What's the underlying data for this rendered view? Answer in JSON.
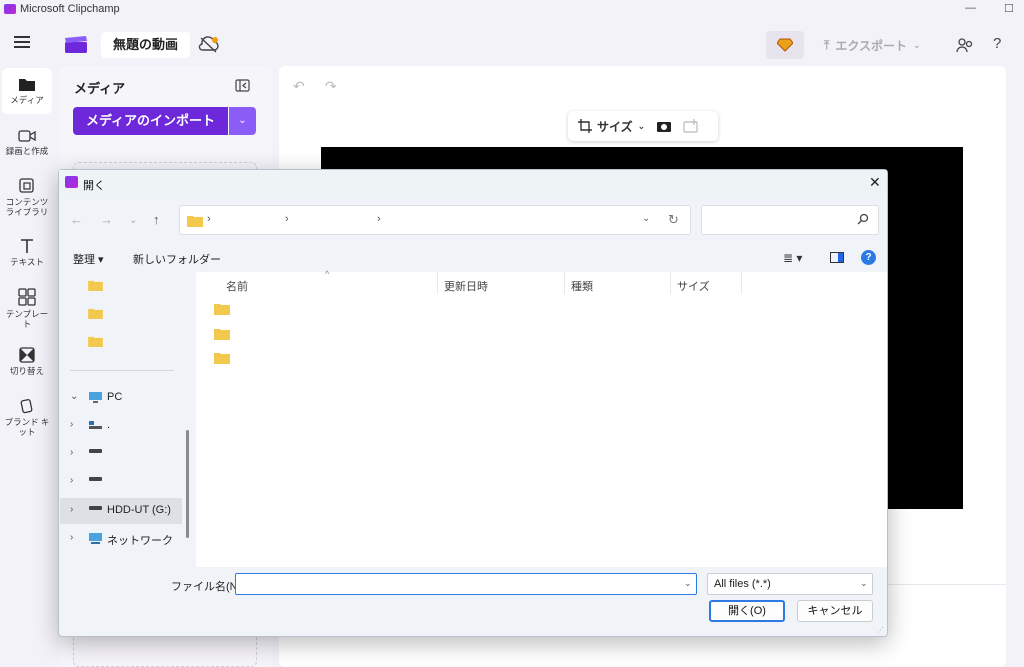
{
  "window": {
    "title": "Microsoft Clipchamp",
    "minimize": "—",
    "maximize": "☐"
  },
  "header": {
    "project_name": "無題の動画",
    "export_label": "エクスポート",
    "help": "?",
    "brand_color": "#6d28d9"
  },
  "rail": {
    "items": [
      {
        "label": "メディア",
        "icon": "folder-icon"
      },
      {
        "label": "録画と作成",
        "icon": "camera-icon"
      },
      {
        "label": "コンテンツ ライブラリ",
        "icon": "library-icon"
      },
      {
        "label": "テキスト",
        "icon": "text-icon"
      },
      {
        "label": "テンプレート",
        "icon": "template-icon"
      },
      {
        "label": "切り替え",
        "icon": "transition-icon"
      },
      {
        "label": "ブランド キット",
        "icon": "brand-kit-icon"
      }
    ]
  },
  "media_panel": {
    "title": "メディア",
    "import_label": "メディアのインポート"
  },
  "editor": {
    "size_label": "サイズ"
  },
  "dialog": {
    "title": "開く",
    "close": "✕",
    "address": {
      "separators": [
        "›",
        "›",
        "›"
      ]
    },
    "commands": {
      "organize": "整理 ▾",
      "new_folder": "新しいフォルダー"
    },
    "nav": {
      "items": [
        {
          "label": "PC",
          "chev": "⌄"
        },
        {
          "label": ".",
          "chev": "›"
        },
        {
          "label": "",
          "chev": "›"
        },
        {
          "label": "",
          "chev": "›"
        },
        {
          "label": "HDD-UT (G:)",
          "chev": "›"
        },
        {
          "label": "ネットワーク",
          "chev": "›"
        }
      ]
    },
    "columns": [
      "名前",
      "更新日時",
      "種類",
      "サイズ"
    ],
    "file_name_label": "ファイル名(N):",
    "file_name_value": "",
    "filter_value": "All files (*.*)",
    "open_label": "開く(O)",
    "cancel_label": "キャンセル"
  }
}
